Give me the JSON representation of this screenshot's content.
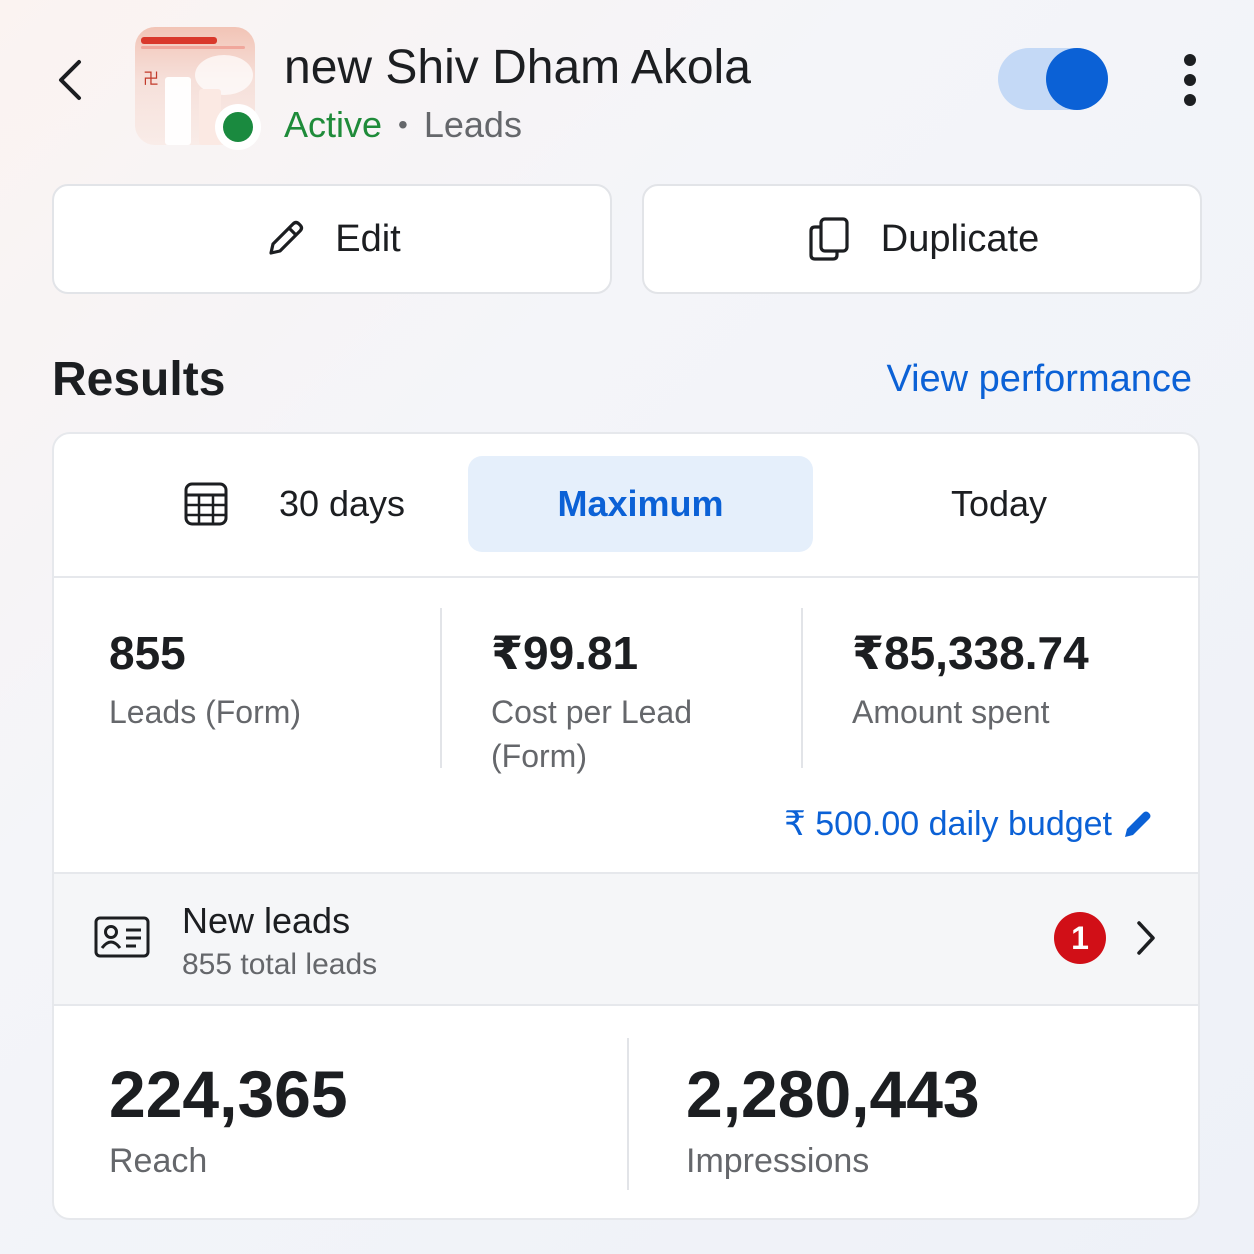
{
  "header": {
    "title": "new Shiv Dham Akola",
    "status": "Active",
    "separator": "•",
    "objective": "Leads",
    "toggle_on": true
  },
  "actions": {
    "edit_label": "Edit",
    "duplicate_label": "Duplicate"
  },
  "results": {
    "heading": "Results",
    "view_performance": "View performance"
  },
  "date_tabs": {
    "items": [
      "30 days",
      "Maximum",
      "Today"
    ],
    "selected": "Maximum"
  },
  "metrics": [
    {
      "value": "855",
      "label": "Leads (Form)"
    },
    {
      "value": "₹99.81",
      "label": "Cost per Lead (Form)"
    },
    {
      "value": "₹85,338.74",
      "label": "Amount spent"
    }
  ],
  "budget": {
    "label": "₹ 500.00 daily budget"
  },
  "new_leads": {
    "title": "New leads",
    "subtitle": "855 total leads",
    "badge_count": "1"
  },
  "reach": {
    "value": "224,365",
    "label": "Reach"
  },
  "impressions": {
    "value": "2,280,443",
    "label": "Impressions"
  },
  "colors": {
    "accent": "#0b61d6",
    "active_green": "#1f8b3a",
    "badge_red": "#d10f17"
  }
}
